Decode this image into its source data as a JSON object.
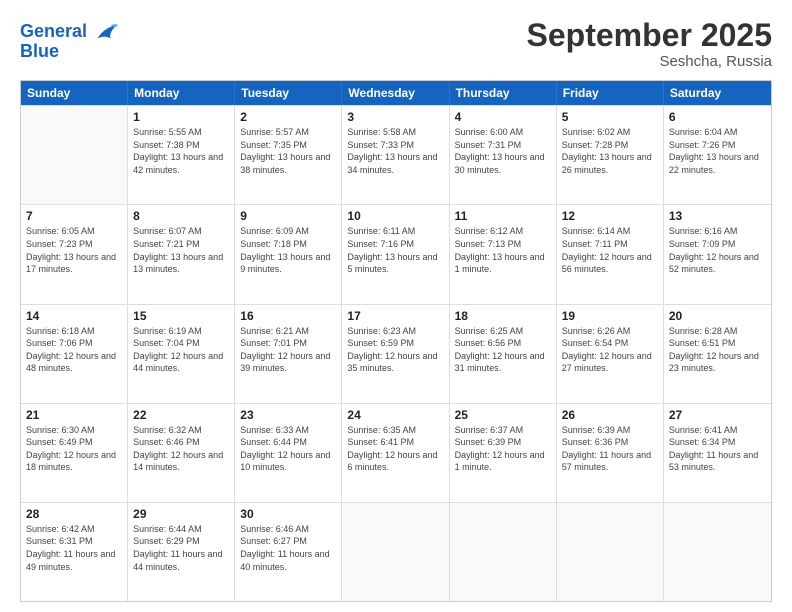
{
  "header": {
    "logo_line1": "General",
    "logo_line2": "Blue",
    "month_title": "September 2025",
    "location": "Seshcha, Russia"
  },
  "days_of_week": [
    "Sunday",
    "Monday",
    "Tuesday",
    "Wednesday",
    "Thursday",
    "Friday",
    "Saturday"
  ],
  "weeks": [
    [
      {
        "day": "",
        "empty": true
      },
      {
        "day": "1",
        "sunrise": "5:55 AM",
        "sunset": "7:38 PM",
        "daylight": "13 hours and 42 minutes."
      },
      {
        "day": "2",
        "sunrise": "5:57 AM",
        "sunset": "7:35 PM",
        "daylight": "13 hours and 38 minutes."
      },
      {
        "day": "3",
        "sunrise": "5:58 AM",
        "sunset": "7:33 PM",
        "daylight": "13 hours and 34 minutes."
      },
      {
        "day": "4",
        "sunrise": "6:00 AM",
        "sunset": "7:31 PM",
        "daylight": "13 hours and 30 minutes."
      },
      {
        "day": "5",
        "sunrise": "6:02 AM",
        "sunset": "7:28 PM",
        "daylight": "13 hours and 26 minutes."
      },
      {
        "day": "6",
        "sunrise": "6:04 AM",
        "sunset": "7:26 PM",
        "daylight": "13 hours and 22 minutes."
      }
    ],
    [
      {
        "day": "7",
        "sunrise": "6:05 AM",
        "sunset": "7:23 PM",
        "daylight": "13 hours and 17 minutes."
      },
      {
        "day": "8",
        "sunrise": "6:07 AM",
        "sunset": "7:21 PM",
        "daylight": "13 hours and 13 minutes."
      },
      {
        "day": "9",
        "sunrise": "6:09 AM",
        "sunset": "7:18 PM",
        "daylight": "13 hours and 9 minutes."
      },
      {
        "day": "10",
        "sunrise": "6:11 AM",
        "sunset": "7:16 PM",
        "daylight": "13 hours and 5 minutes."
      },
      {
        "day": "11",
        "sunrise": "6:12 AM",
        "sunset": "7:13 PM",
        "daylight": "13 hours and 1 minute."
      },
      {
        "day": "12",
        "sunrise": "6:14 AM",
        "sunset": "7:11 PM",
        "daylight": "12 hours and 56 minutes."
      },
      {
        "day": "13",
        "sunrise": "6:16 AM",
        "sunset": "7:09 PM",
        "daylight": "12 hours and 52 minutes."
      }
    ],
    [
      {
        "day": "14",
        "sunrise": "6:18 AM",
        "sunset": "7:06 PM",
        "daylight": "12 hours and 48 minutes."
      },
      {
        "day": "15",
        "sunrise": "6:19 AM",
        "sunset": "7:04 PM",
        "daylight": "12 hours and 44 minutes."
      },
      {
        "day": "16",
        "sunrise": "6:21 AM",
        "sunset": "7:01 PM",
        "daylight": "12 hours and 39 minutes."
      },
      {
        "day": "17",
        "sunrise": "6:23 AM",
        "sunset": "6:59 PM",
        "daylight": "12 hours and 35 minutes."
      },
      {
        "day": "18",
        "sunrise": "6:25 AM",
        "sunset": "6:56 PM",
        "daylight": "12 hours and 31 minutes."
      },
      {
        "day": "19",
        "sunrise": "6:26 AM",
        "sunset": "6:54 PM",
        "daylight": "12 hours and 27 minutes."
      },
      {
        "day": "20",
        "sunrise": "6:28 AM",
        "sunset": "6:51 PM",
        "daylight": "12 hours and 23 minutes."
      }
    ],
    [
      {
        "day": "21",
        "sunrise": "6:30 AM",
        "sunset": "6:49 PM",
        "daylight": "12 hours and 18 minutes."
      },
      {
        "day": "22",
        "sunrise": "6:32 AM",
        "sunset": "6:46 PM",
        "daylight": "12 hours and 14 minutes."
      },
      {
        "day": "23",
        "sunrise": "6:33 AM",
        "sunset": "6:44 PM",
        "daylight": "12 hours and 10 minutes."
      },
      {
        "day": "24",
        "sunrise": "6:35 AM",
        "sunset": "6:41 PM",
        "daylight": "12 hours and 6 minutes."
      },
      {
        "day": "25",
        "sunrise": "6:37 AM",
        "sunset": "6:39 PM",
        "daylight": "12 hours and 1 minute."
      },
      {
        "day": "26",
        "sunrise": "6:39 AM",
        "sunset": "6:36 PM",
        "daylight": "11 hours and 57 minutes."
      },
      {
        "day": "27",
        "sunrise": "6:41 AM",
        "sunset": "6:34 PM",
        "daylight": "11 hours and 53 minutes."
      }
    ],
    [
      {
        "day": "28",
        "sunrise": "6:42 AM",
        "sunset": "6:31 PM",
        "daylight": "11 hours and 49 minutes."
      },
      {
        "day": "29",
        "sunrise": "6:44 AM",
        "sunset": "6:29 PM",
        "daylight": "11 hours and 44 minutes."
      },
      {
        "day": "30",
        "sunrise": "6:46 AM",
        "sunset": "6:27 PM",
        "daylight": "11 hours and 40 minutes."
      },
      {
        "day": "",
        "empty": true
      },
      {
        "day": "",
        "empty": true
      },
      {
        "day": "",
        "empty": true
      },
      {
        "day": "",
        "empty": true
      }
    ]
  ]
}
